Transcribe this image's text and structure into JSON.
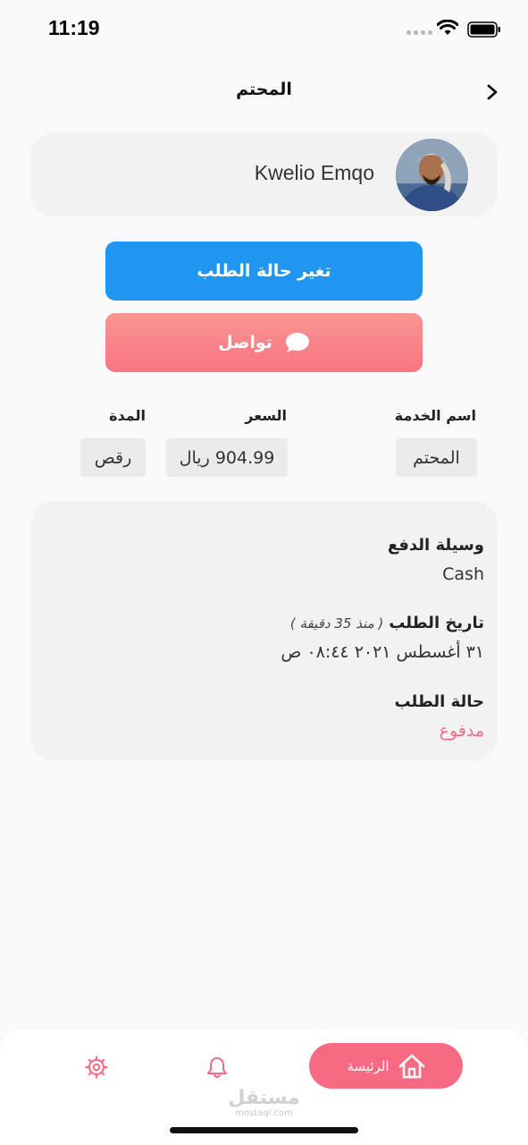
{
  "status_bar": {
    "time": "11:19"
  },
  "header": {
    "title": "المحتم"
  },
  "profile": {
    "name": "Kwelio Emqo"
  },
  "buttons": {
    "change_status": "تغير حالة الطلب",
    "contact": "تواصل"
  },
  "service": {
    "name_label": "اسم الخدمة",
    "name_value": "المحتم",
    "price_label": "السعر",
    "price_value": "904.99 ريال",
    "duration_label": "المدة",
    "duration_value": "رقص"
  },
  "details": {
    "payment_label": "وسيلة الدفع",
    "payment_value": "Cash",
    "date_label": "تاريخ الطلب",
    "date_ago": "( منذ 35 دقيقة )",
    "date_value": "٣١ أغسطس ٢٠٢١  ٠٨:٤٤ ص",
    "status_label": "حالة الطلب",
    "status_value": "مدفوع"
  },
  "bottom_nav": {
    "home_label": "الرئيسة"
  },
  "watermark": {
    "text": "مستقل",
    "sub": "mostaql.com"
  },
  "colors": {
    "primary_blue": "#2196f0",
    "accent_pink": "#f66a82",
    "status_paid": "#f16c86"
  }
}
